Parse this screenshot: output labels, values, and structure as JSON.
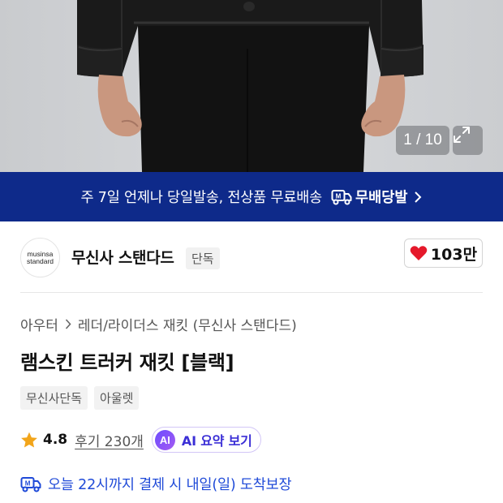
{
  "gallery": {
    "counter": "1 / 10",
    "expand_icon": "expand-icon"
  },
  "banner": {
    "text": "주 7일 언제나 당일발송, 전상품 무료배송",
    "brand": "무배당발",
    "color": "#0e2a8a"
  },
  "brand": {
    "logo_line1": "musinsa",
    "logo_line2": "standard",
    "name": "무신사 스탠다드",
    "badge": "단독",
    "likes": "103만",
    "heart_color": "#e5192b"
  },
  "product": {
    "breadcrumb": [
      "아우터",
      "레더/라이더스 재킷 (무신사 스탠다드)"
    ],
    "title": "램스킨 트러커 재킷 [블랙]",
    "tags": [
      "무신사단독",
      "아울렛"
    ],
    "rating": "4.8",
    "reviews": "후기 230개",
    "ai_badge": "AI",
    "ai_label": "AI 요약 보기",
    "delivery": "오늘 22시까지 결제 시 내일(일) 도착보장",
    "accent_color": "#1f4ad8",
    "star_color": "#f2a51a"
  }
}
